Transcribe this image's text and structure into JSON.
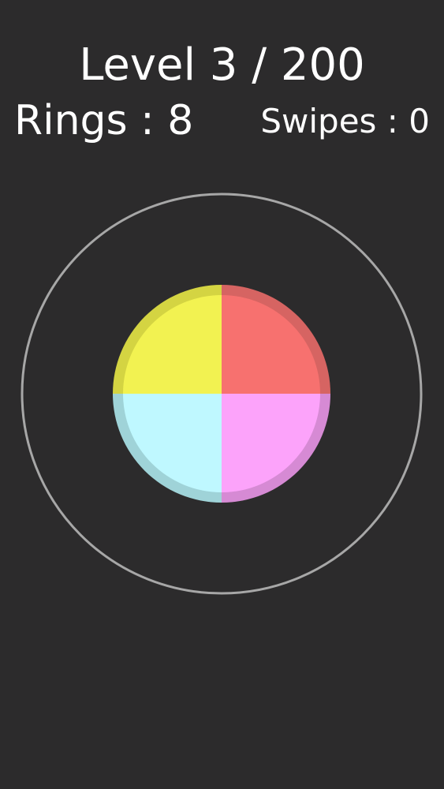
{
  "hud": {
    "level_text": "Level 3 / 200",
    "rings_text": "Rings : 8",
    "swipes_text": "Swipes : 0"
  },
  "game": {
    "target_ring_color": "#a7a7a7",
    "background_color": "#2c2b2c",
    "quadrants": [
      {
        "name": "top-left",
        "color": "#f2f251",
        "rim": "#d4d442"
      },
      {
        "name": "top-right",
        "color": "#f7716f",
        "rim": "#d66462"
      },
      {
        "name": "bottom-left",
        "color": "#bff8ff",
        "rim": "#9fd3d8"
      },
      {
        "name": "bottom-right",
        "color": "#fca3fa",
        "rim": "#d68ad4"
      }
    ]
  }
}
